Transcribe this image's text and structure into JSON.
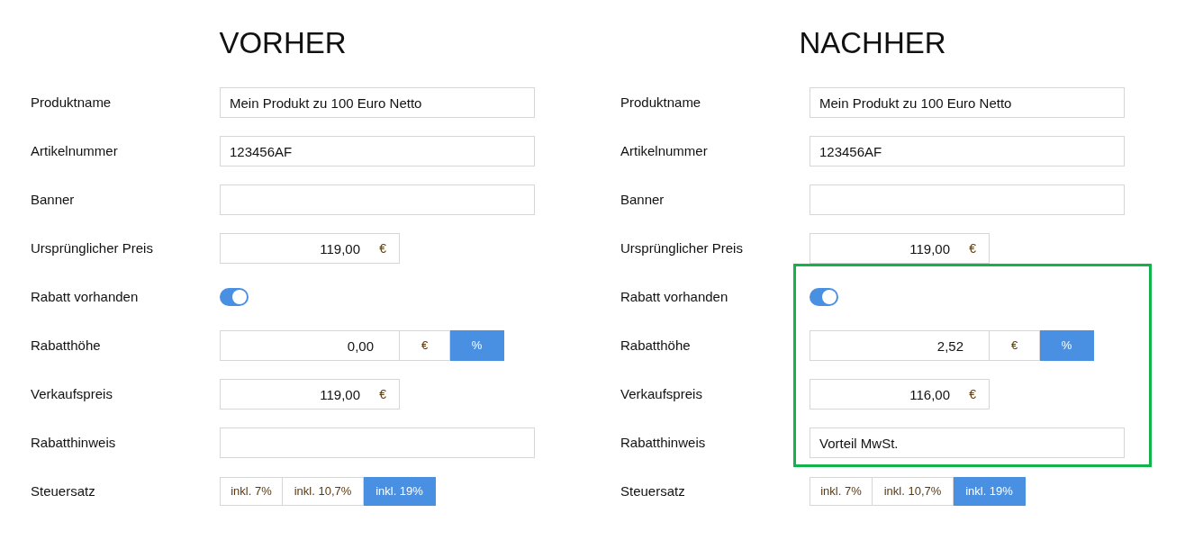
{
  "panels": [
    {
      "title": "VORHER",
      "fields": [
        {
          "kind": "text",
          "label": "Produktname",
          "value": "Mein Produkt zu 100 Euro Netto",
          "highlighted": false
        },
        {
          "kind": "text",
          "label": "Artikelnummer",
          "value": "123456AF",
          "highlighted": false
        },
        {
          "kind": "text",
          "label": "Banner",
          "highlighted": false
        },
        {
          "kind": "price",
          "label": "Ursprünglicher Preis",
          "value": "119,00",
          "currency": "€",
          "highlighted": false
        },
        {
          "kind": "toggle",
          "label": "Rabatt vorhanden",
          "on": true,
          "highlighted": false
        },
        {
          "kind": "discount",
          "label": "Rabatthöhe",
          "value": "0,00",
          "options": [
            {
              "label": "€",
              "selected": false
            },
            {
              "label": "%",
              "selected": true
            }
          ],
          "highlighted": false
        },
        {
          "kind": "price",
          "label": "Verkaufspreis",
          "value": "119,00",
          "currency": "€",
          "highlighted": false
        },
        {
          "kind": "text",
          "label": "Rabatthinweis",
          "highlighted": false
        },
        {
          "kind": "segments",
          "label": "Steuersatz",
          "options": [
            {
              "label": "inkl. 7%",
              "selected": false
            },
            {
              "label": "inkl. 10,7%",
              "selected": false
            },
            {
              "label": "inkl. 19%",
              "selected": true
            }
          ],
          "highlighted": false
        }
      ]
    },
    {
      "title": "NACHHER",
      "fields": [
        {
          "kind": "text",
          "label": "Produktname",
          "value": "Mein Produkt zu 100 Euro Netto",
          "highlighted": false
        },
        {
          "kind": "text",
          "label": "Artikelnummer",
          "value": "123456AF",
          "highlighted": false
        },
        {
          "kind": "text",
          "label": "Banner",
          "highlighted": false
        },
        {
          "kind": "price",
          "label": "Ursprünglicher Preis",
          "value": "119,00",
          "currency": "€",
          "highlighted": false
        },
        {
          "kind": "toggle",
          "label": "Rabatt vorhanden",
          "on": true,
          "highlighted": true
        },
        {
          "kind": "discount",
          "label": "Rabatthöhe",
          "value": "2,52",
          "options": [
            {
              "label": "€",
              "selected": false
            },
            {
              "label": "%",
              "selected": true
            }
          ],
          "highlighted": true
        },
        {
          "kind": "price",
          "label": "Verkaufspreis",
          "value": "116,00",
          "currency": "€",
          "highlighted": true
        },
        {
          "kind": "text",
          "label": "Rabatthinweis",
          "value": "Vorteil MwSt.",
          "highlighted": true
        },
        {
          "kind": "segments",
          "label": "Steuersatz",
          "options": [
            {
              "label": "inkl. 7%",
              "selected": false
            },
            {
              "label": "inkl. 10,7%",
              "selected": false
            },
            {
              "label": "inkl. 19%",
              "selected": true
            }
          ],
          "highlighted": false
        }
      ]
    }
  ]
}
